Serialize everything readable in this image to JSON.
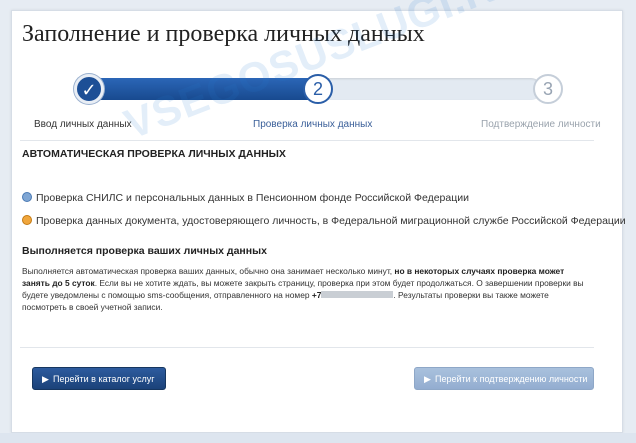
{
  "page": {
    "title": "Заполнение и проверка личных данных",
    "watermark": "VSEGOSUSLUGI.RU"
  },
  "stepper": {
    "steps": [
      {
        "number": "✓",
        "label": "Ввод личных данных",
        "state": "done"
      },
      {
        "number": "2",
        "label": "Проверка личных данных",
        "state": "active"
      },
      {
        "number": "3",
        "label": "Подтверждение личности",
        "state": "pending"
      }
    ]
  },
  "check": {
    "heading": "АВТОМАТИЧЕСКАЯ ПРОВЕРКА ЛИЧНЫХ ДАННЫХ",
    "items": [
      {
        "text": "Проверка СНИЛС и персональных данных в Пенсионном фонде Российской Федерации",
        "status_color": "#7fa6d4"
      },
      {
        "text": "Проверка данных документа, удостоверяющего личность, в Федеральной миграционной службе Российской Федерации",
        "status_color": "#f0a63c"
      }
    ]
  },
  "progress": {
    "heading": "Выполняется проверка ваших личных данных",
    "text_1": "Выполняется автоматическая проверка ваших данных, обычно она занимает несколько минут,",
    "text_bold": "но в некоторых случаях проверка может занять до 5 суток",
    "text_2": ". Если вы не хотите ждать, вы можете закрыть страницу, проверка при этом будет продолжаться. О завершении проверки вы будете уведомлены с помощью sms-сообщения, отправленного на номер",
    "phone_prefix": "+7",
    "text_3": ". Результаты проверки вы также можете посмотреть в своей учетной записи."
  },
  "buttons": {
    "catalog": "Перейти в каталог услуг",
    "confirm": "Перейти к подтверждению личности"
  },
  "colors": {
    "accent": "#1d4f96",
    "disabled_button": "#a9c1dd"
  }
}
